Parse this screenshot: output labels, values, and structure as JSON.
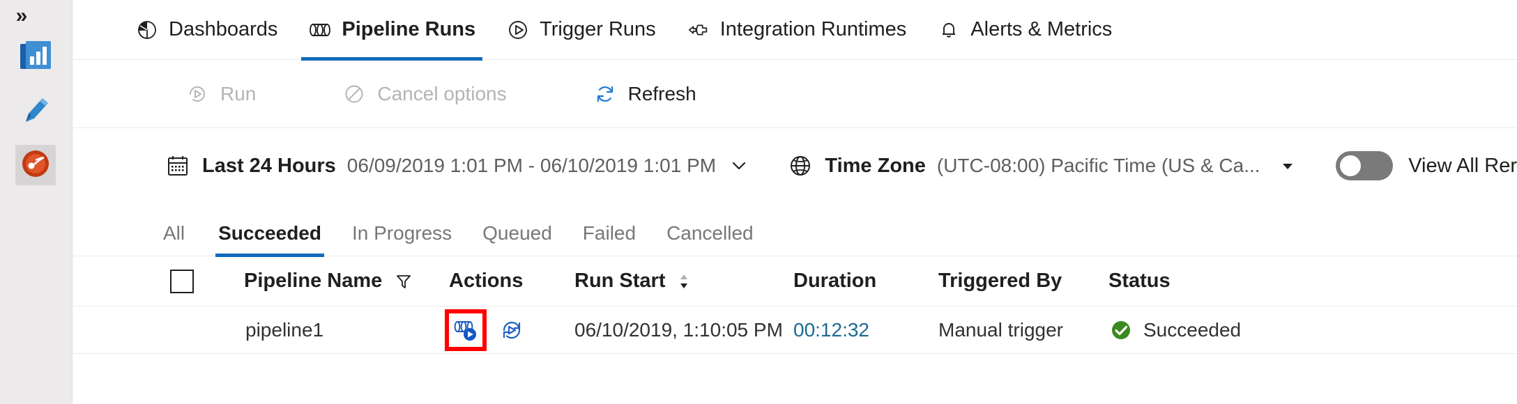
{
  "rail": {
    "expand_label": "»",
    "items": [
      {
        "name": "monitor-icon",
        "label": "Monitor"
      },
      {
        "name": "author-pencil-icon",
        "label": "Author"
      },
      {
        "name": "manage-icon",
        "label": "Manage"
      }
    ]
  },
  "nav": {
    "tabs": [
      {
        "label": "Dashboards",
        "icon": "pie-chart-icon",
        "active": false
      },
      {
        "label": "Pipeline Runs",
        "icon": "pipeline-icon",
        "active": true
      },
      {
        "label": "Trigger Runs",
        "icon": "play-circle-icon",
        "active": false
      },
      {
        "label": "Integration Runtimes",
        "icon": "integration-runtime-icon",
        "active": false
      },
      {
        "label": "Alerts & Metrics",
        "icon": "bell-icon",
        "active": false
      }
    ]
  },
  "commandbar": {
    "run_label": "Run",
    "run_icon": "run-icon",
    "run_disabled": true,
    "cancel_label": "Cancel options",
    "cancel_icon": "cancel-circle-icon",
    "cancel_disabled": true,
    "refresh_label": "Refresh",
    "refresh_icon": "refresh-icon"
  },
  "filterbar": {
    "calendar_icon": "calendar-icon",
    "range_label": "Last 24 Hours",
    "range_value": "06/09/2019 1:01 PM - 06/10/2019 1:01 PM",
    "range_chevron": "chevron-down-icon",
    "globe_icon": "globe-icon",
    "timezone_label": "Time Zone",
    "timezone_value": "(UTC-08:00) Pacific Time (US & Ca...",
    "timezone_caret": "caret-down-icon",
    "toggle_name": "view-all-runs-toggle",
    "toggle_on": false,
    "toggle_label": "View All Rer"
  },
  "status_tabs": [
    {
      "label": "All",
      "active": false
    },
    {
      "label": "Succeeded",
      "active": true
    },
    {
      "label": "In Progress",
      "active": false
    },
    {
      "label": "Queued",
      "active": false
    },
    {
      "label": "Failed",
      "active": false
    },
    {
      "label": "Cancelled",
      "active": false
    }
  ],
  "table": {
    "headers": {
      "pipeline_name": "Pipeline Name",
      "actions": "Actions",
      "run_start": "Run Start",
      "duration": "Duration",
      "triggered_by": "Triggered By",
      "status": "Status"
    },
    "rows": [
      {
        "pipeline_name": "pipeline1",
        "actions": [
          {
            "name": "view-activity-runs-icon",
            "highlighted": true
          },
          {
            "name": "rerun-icon",
            "highlighted": false
          }
        ],
        "run_start": "06/10/2019, 1:10:05 PM",
        "duration": "00:12:32",
        "triggered_by": "Manual trigger",
        "status": "Succeeded",
        "status_icon": "success-check-icon"
      }
    ]
  },
  "colors": {
    "accent": "#0f6cbd",
    "link": "#1a6b8f",
    "success": "#3b8a21",
    "highlight": "#ff0000",
    "rail_bg": "#eceaea",
    "muted_text": "#605e5c"
  }
}
